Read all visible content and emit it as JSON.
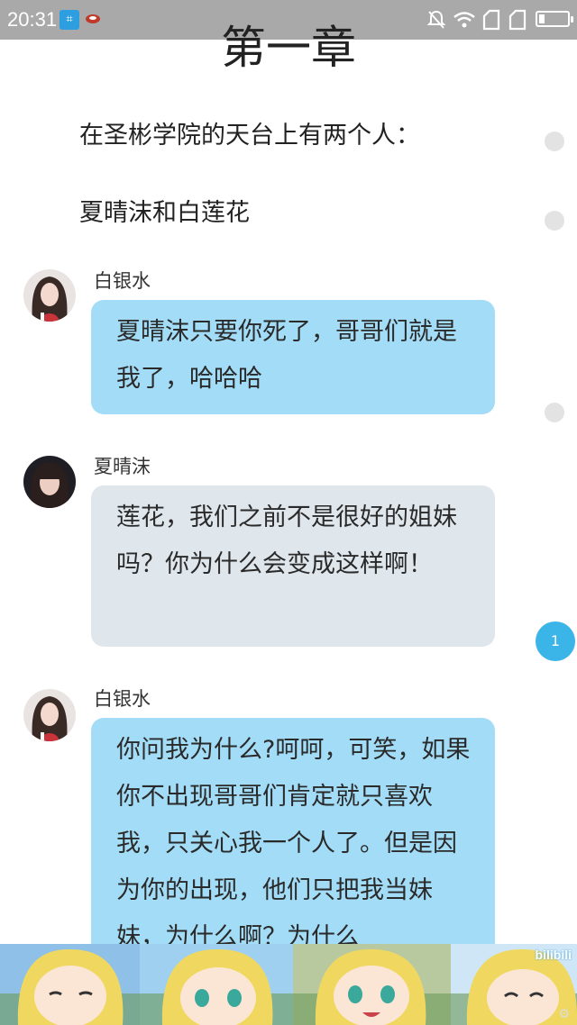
{
  "status_bar": {
    "time": "20:31"
  },
  "chapter": {
    "title": "第一章"
  },
  "narration": [
    {
      "text": "在圣彬学院的天台上有两个人："
    },
    {
      "text": "夏晴沫和白莲花"
    }
  ],
  "messages": [
    {
      "speaker": "白银水",
      "text": "夏晴沫只要你死了，哥哥们就是我了，哈哈哈",
      "style": "blue"
    },
    {
      "speaker": "夏晴沫",
      "text": "莲花，我们之前不是很好的姐妹吗？你为什么会变成这样啊！",
      "style": "gray"
    },
    {
      "speaker": "白银水",
      "text": "你问我为什么?呵呵，可笑，如果你不出现哥哥们肯定就只喜欢我，只关心我一个人了。但是因为你的出现，他们只把我当妹妹，为什么啊？为什么",
      "style": "blue"
    }
  ],
  "badge": {
    "count": "1"
  },
  "stickers": {
    "brand_text": "bilibili"
  },
  "colors": {
    "status_bar": "#a9a9a9",
    "bubble_blue": "#a3dcf6",
    "bubble_gray": "#dfe6ec",
    "badge": "#3bb4e8"
  }
}
